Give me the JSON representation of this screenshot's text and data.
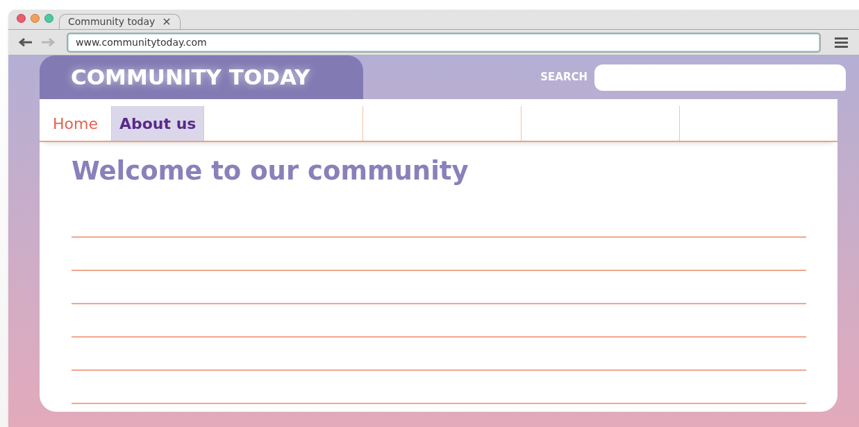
{
  "browser": {
    "tab": {
      "title": "Community today",
      "close": "✕"
    },
    "nav_buttons": [
      {
        "kind": "back",
        "disabled": false
      },
      {
        "kind": "forward",
        "disabled": true
      }
    ],
    "address": "www.communitytoday.com"
  },
  "site": {
    "logo": "COMMUNITY TODAY",
    "search": {
      "label": "SEARCH"
    },
    "nav": [
      {
        "label": "Home",
        "selected": false
      },
      {
        "label": "About us",
        "selected": true
      }
    ],
    "heading": "Welcome to our community"
  }
}
